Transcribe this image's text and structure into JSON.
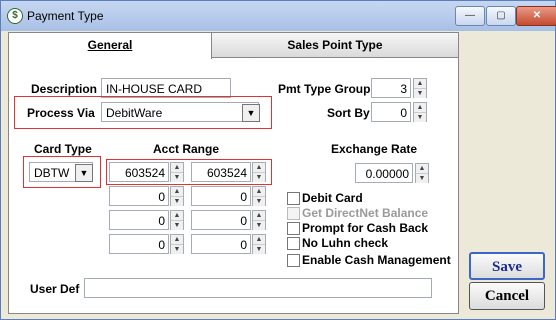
{
  "window": {
    "title": "Payment Type",
    "minimize": "—",
    "maximize": "▢",
    "close": "✕"
  },
  "tabs": [
    {
      "label": "General"
    },
    {
      "label": "Sales Point Type"
    }
  ],
  "general": {
    "description_label": "Description",
    "description_value": "IN-HOUSE CARD",
    "process_via_label": "Process Via",
    "process_via_value": "DebitWare",
    "pmt_type_group_label": "Pmt Type Group",
    "pmt_type_group_value": "3",
    "sort_by_label": "Sort By",
    "sort_by_value": "0",
    "card_type_label": "Card Type",
    "card_type_value": "DBTW",
    "acct_range_label": "Acct Range",
    "acct_ranges": [
      [
        "603524",
        "603524"
      ],
      [
        "0",
        "0"
      ],
      [
        "0",
        "0"
      ],
      [
        "0",
        "0"
      ]
    ],
    "exchange_rate_label": "Exchange Rate",
    "exchange_rate_value": "0.00000",
    "checkboxes": [
      {
        "label": "Debit Card"
      },
      {
        "label": "Get DirectNet Balance"
      },
      {
        "label": "Prompt for Cash Back"
      },
      {
        "label": "No Luhn check"
      },
      {
        "label": "Enable Cash Management"
      }
    ],
    "user_def_label": "User Def",
    "user_def_value": ""
  },
  "buttons": {
    "save": "Save",
    "cancel": "Cancel"
  }
}
